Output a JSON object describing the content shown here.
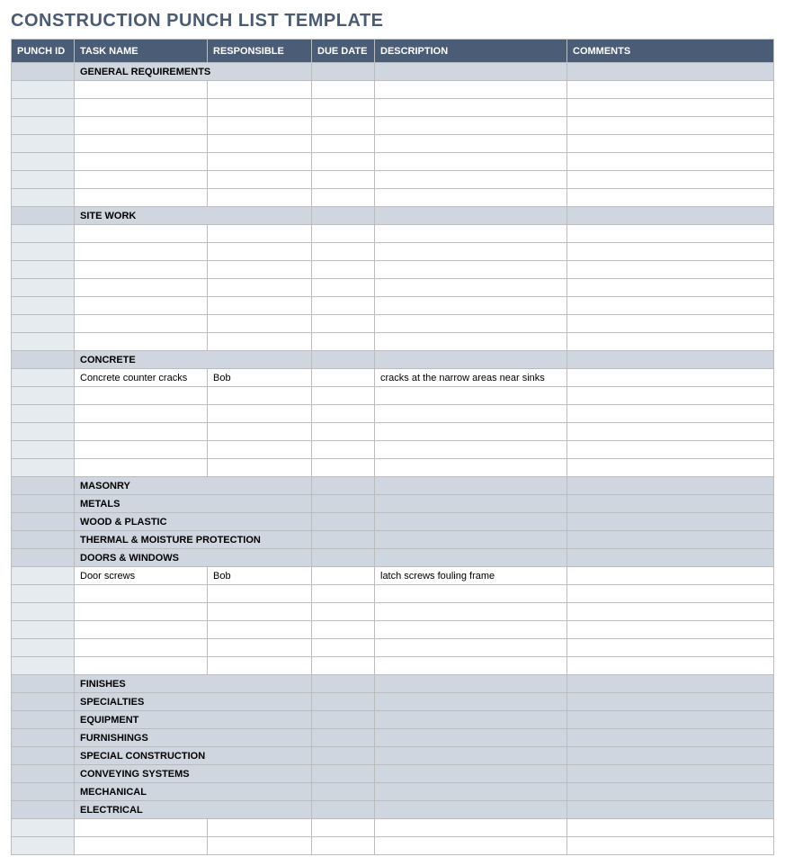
{
  "title": "CONSTRUCTION PUNCH LIST TEMPLATE",
  "columns": {
    "punch_id": "PUNCH ID",
    "task_name": "TASK NAME",
    "responsible": "RESPONSIBLE",
    "due_date": "DUE DATE",
    "description": "DESCRIPTION",
    "comments": "COMMENTS"
  },
  "rows": [
    {
      "type": "section",
      "task_name": "GENERAL REQUIREMENTS"
    },
    {
      "type": "data"
    },
    {
      "type": "data"
    },
    {
      "type": "data"
    },
    {
      "type": "data"
    },
    {
      "type": "data"
    },
    {
      "type": "data"
    },
    {
      "type": "data"
    },
    {
      "type": "section",
      "task_name": "SITE WORK"
    },
    {
      "type": "data"
    },
    {
      "type": "data"
    },
    {
      "type": "data"
    },
    {
      "type": "data"
    },
    {
      "type": "data"
    },
    {
      "type": "data"
    },
    {
      "type": "data"
    },
    {
      "type": "section",
      "task_name": "CONCRETE"
    },
    {
      "type": "data",
      "task_name": "Concrete counter cracks",
      "responsible": "Bob",
      "description": "cracks at the narrow areas near sinks"
    },
    {
      "type": "data"
    },
    {
      "type": "data"
    },
    {
      "type": "data"
    },
    {
      "type": "data"
    },
    {
      "type": "data"
    },
    {
      "type": "section",
      "task_name": "MASONRY"
    },
    {
      "type": "section",
      "task_name": "METALS"
    },
    {
      "type": "section",
      "task_name": "WOOD & PLASTIC"
    },
    {
      "type": "section",
      "task_name": "THERMAL & MOISTURE PROTECTION"
    },
    {
      "type": "section",
      "task_name": "DOORS & WINDOWS"
    },
    {
      "type": "data",
      "task_name": "Door screws",
      "responsible": "Bob",
      "description": "latch screws fouling frame"
    },
    {
      "type": "data"
    },
    {
      "type": "data"
    },
    {
      "type": "data"
    },
    {
      "type": "data"
    },
    {
      "type": "data"
    },
    {
      "type": "section",
      "task_name": "FINISHES"
    },
    {
      "type": "section",
      "task_name": "SPECIALTIES"
    },
    {
      "type": "section",
      "task_name": "EQUIPMENT"
    },
    {
      "type": "section",
      "task_name": "FURNISHINGS"
    },
    {
      "type": "section",
      "task_name": "SPECIAL CONSTRUCTION"
    },
    {
      "type": "section",
      "task_name": "CONVEYING SYSTEMS"
    },
    {
      "type": "section",
      "task_name": "MECHANICAL"
    },
    {
      "type": "section",
      "task_name": "ELECTRICAL"
    },
    {
      "type": "data"
    },
    {
      "type": "data"
    }
  ]
}
